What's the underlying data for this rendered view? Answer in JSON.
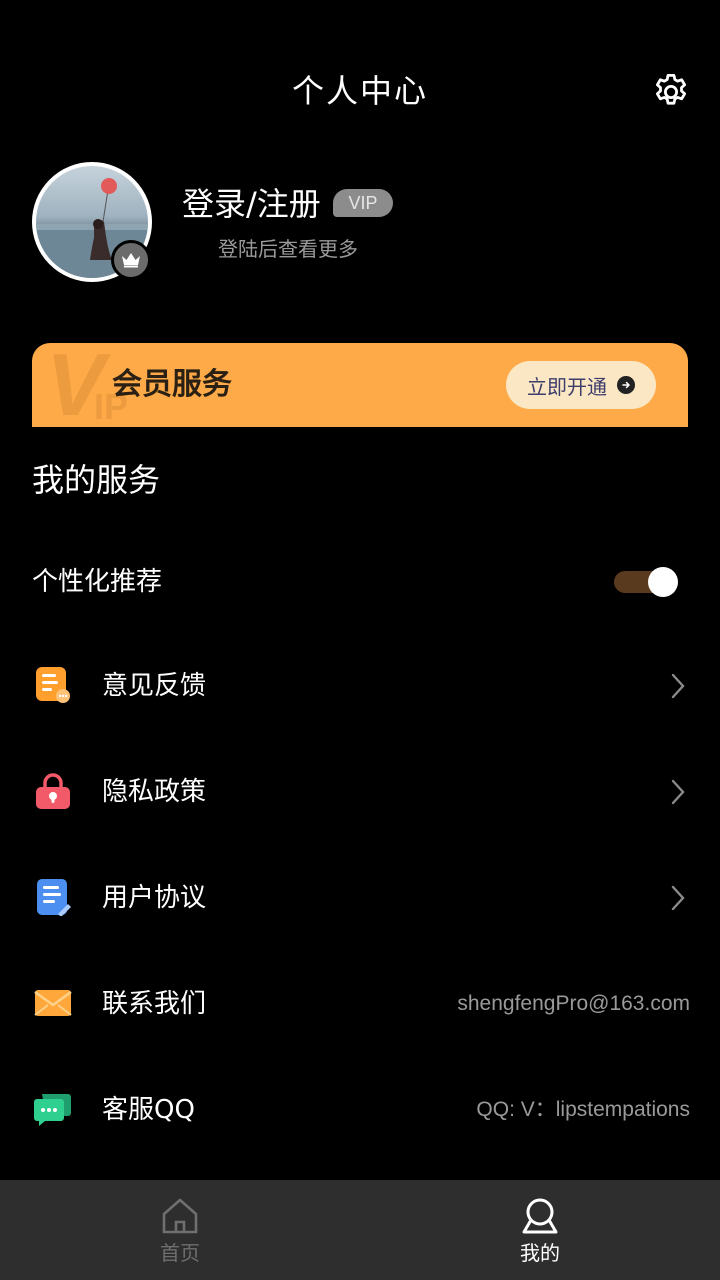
{
  "header": {
    "title": "个人中心"
  },
  "profile": {
    "name": "登录/注册",
    "vip_badge": "VIP",
    "subtitle": "登陆后查看更多"
  },
  "vip_banner": {
    "watermark": "V",
    "watermark_small": "IP",
    "title": "会员服务",
    "button_label": "立即开通"
  },
  "services": {
    "section_title": "我的服务",
    "personalized": {
      "label": "个性化推荐",
      "enabled": true
    },
    "items": [
      {
        "label": "意见反馈",
        "icon": "feedback-icon",
        "color": "#ff9f2e"
      },
      {
        "label": "隐私政策",
        "icon": "lock-icon",
        "color": "#f25a6a"
      },
      {
        "label": "用户协议",
        "icon": "document-icon",
        "color": "#4d8ff0"
      },
      {
        "label": "联系我们",
        "icon": "mail-icon",
        "color": "#ffa73a",
        "value": "shengfengPro@163.com"
      },
      {
        "label": "客服QQ",
        "icon": "chat-icon",
        "color": "#2fd08f",
        "value": "QQ: V：lipstempations"
      }
    ]
  },
  "bottom_nav": {
    "items": [
      {
        "label": "首页",
        "icon": "home-icon",
        "active": false
      },
      {
        "label": "我的",
        "icon": "user-icon",
        "active": true
      }
    ]
  },
  "colors": {
    "background": "#000000",
    "vip_banner": "#ffaa48",
    "nav_bar": "#2e2e2e",
    "toggle_track": "#5a3a1e"
  }
}
